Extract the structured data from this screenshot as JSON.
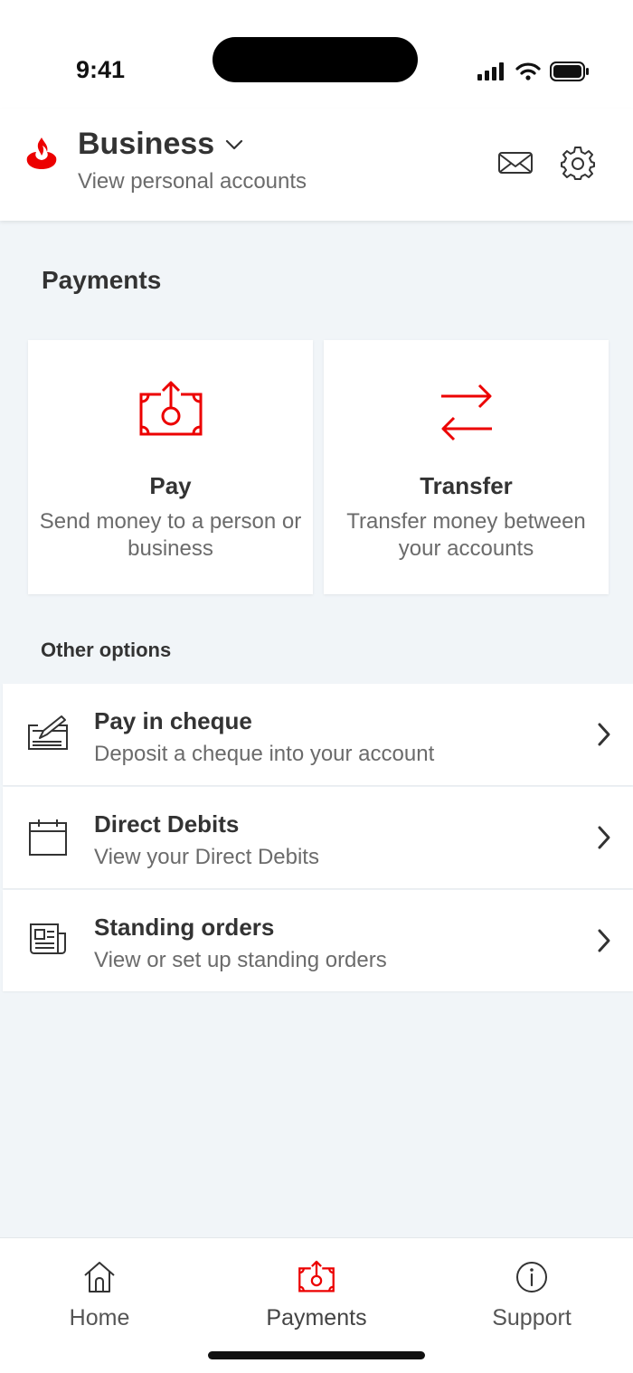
{
  "status_bar": {
    "time": "9:41"
  },
  "header": {
    "title": "Business",
    "subtitle": "View personal accounts",
    "icons": [
      "santander-flame-logo",
      "mail-icon",
      "settings-gear-icon",
      "chevron-down-icon"
    ]
  },
  "payments": {
    "title": "Payments",
    "cards": [
      {
        "title": "Pay",
        "description": "Send money to a person or business",
        "icon": "pay-money-icon"
      },
      {
        "title": "Transfer",
        "description": "Transfer money between your accounts",
        "icon": "transfer-arrows-icon"
      }
    ]
  },
  "other_options": {
    "title": "Other options",
    "items": [
      {
        "title": "Pay in cheque",
        "description": "Deposit a cheque into your account",
        "icon": "cheque-icon"
      },
      {
        "title": "Direct Debits",
        "description": "View your Direct Debits",
        "icon": "calendar-icon"
      },
      {
        "title": "Standing orders",
        "description": "View or set up standing orders",
        "icon": "document-icon"
      }
    ]
  },
  "tab_bar": {
    "tabs": [
      {
        "label": "Home",
        "icon": "home-icon",
        "active": false
      },
      {
        "label": "Payments",
        "icon": "payments-icon",
        "active": true
      },
      {
        "label": "Support",
        "icon": "info-icon",
        "active": false
      }
    ]
  },
  "colors": {
    "brand_red": "#ec0000",
    "text_dark": "#333333",
    "text_muted": "#6b6b6b",
    "background": "#f1f5f8"
  }
}
